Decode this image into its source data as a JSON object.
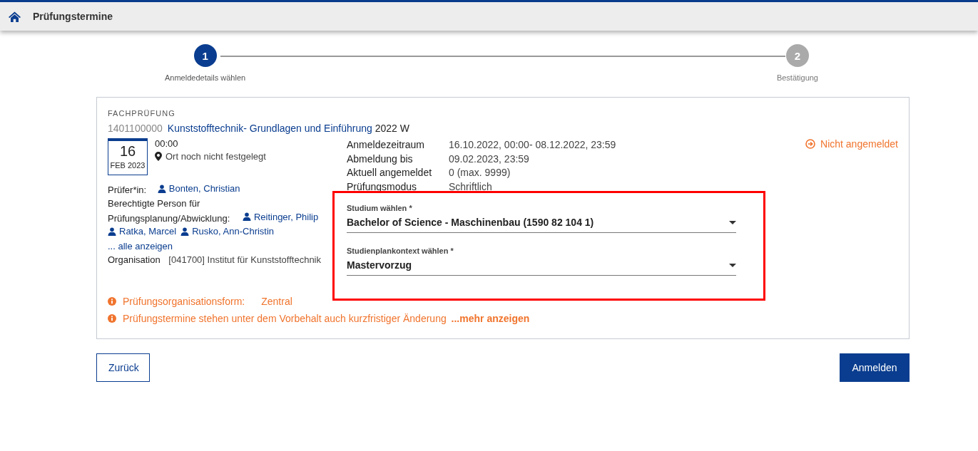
{
  "header": {
    "title": "Prüfungstermine"
  },
  "steps": [
    {
      "number": "1",
      "label": "Anmeldedetails wählen",
      "selected": true
    },
    {
      "number": "2",
      "label": "Bestätigung",
      "selected": false
    }
  ],
  "exam": {
    "type_label": "FACHPRÜFUNG",
    "code": "1401100000",
    "title": "Kunststofftechnik- Grundlagen und Einführung",
    "semester": "2022 W",
    "day": "16",
    "month_year": "FEB 2023",
    "time": "00:00",
    "location": "Ort noch nicht festgelegt",
    "examiner_label": "Prüfer*in:",
    "examiners": [
      "Bonten, Christian"
    ],
    "responsible_label_1": "Berechtigte Person für",
    "responsible_label_2": "Prüfungsplanung/Abwicklung:",
    "responsible": [
      "Reitinger, Philip",
      "Ratka, Marcel",
      "Rusko, Ann-Christin"
    ],
    "show_all": "... alle anzeigen",
    "org_label": "Organisation",
    "org_value": "[041700] Institut für Kunststofftechnik",
    "details": [
      {
        "label": "Anmeldezeitraum",
        "value": "16.10.2022, 00:00- 08.12.2022, 23:59"
      },
      {
        "label": "Abmeldung bis",
        "value": "09.02.2023, 23:59"
      },
      {
        "label": "Aktuell angemeldet",
        "value": "0 (max. 9999)"
      },
      {
        "label": "Prüfungsmodus",
        "value": "Schriftlich"
      }
    ],
    "status": "Nicht angemeldet",
    "notices": [
      {
        "kind": "labeled",
        "label": "Prüfungsorganisationsform:",
        "value": "Zentral"
      },
      {
        "kind": "link",
        "text": "Prüfungstermine stehen unter dem Vorbehalt auch kurzfristiger Änderung",
        "link": "...mehr anzeigen"
      }
    ]
  },
  "selection": {
    "fields": [
      {
        "label": "Studium wählen *",
        "value": "Bachelor of Science - Maschinenbau (1590 82 104 1)"
      },
      {
        "label": "Studienplankontext wählen *",
        "value": "Mastervorzug"
      }
    ]
  },
  "buttons": {
    "back": "Zurück",
    "submit": "Anmelden"
  }
}
